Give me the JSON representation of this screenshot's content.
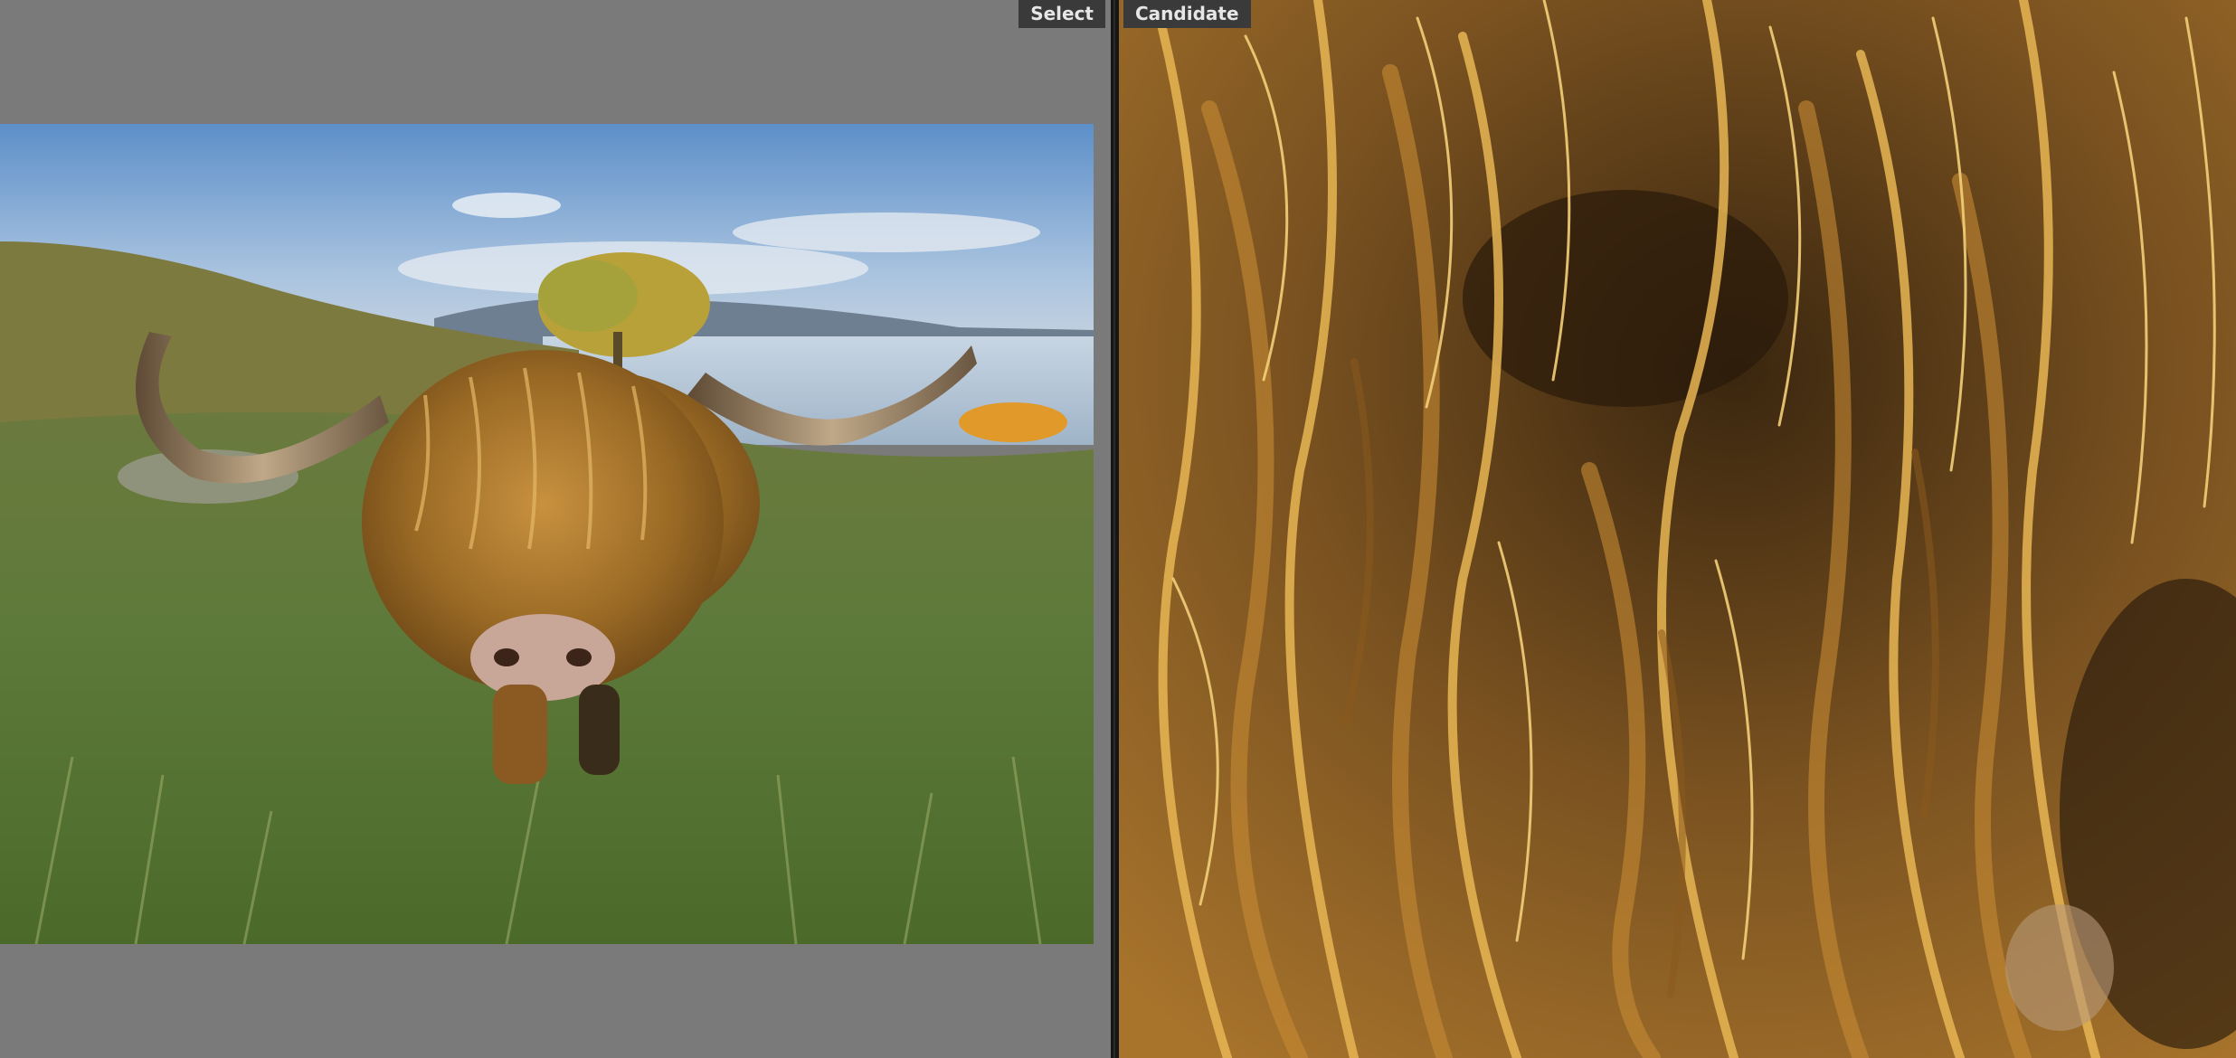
{
  "compare_view": {
    "left": {
      "label": "Select",
      "image": "highland-cow-grazing-by-lake"
    },
    "right": {
      "label": "Candidate",
      "image": "highland-cow-fur-close-up"
    }
  },
  "colors": {
    "workspace_gray": "#7a7a7a",
    "divider": "#161616",
    "label_bg": "#3a3a3a",
    "label_text": "#e6e6e6"
  }
}
